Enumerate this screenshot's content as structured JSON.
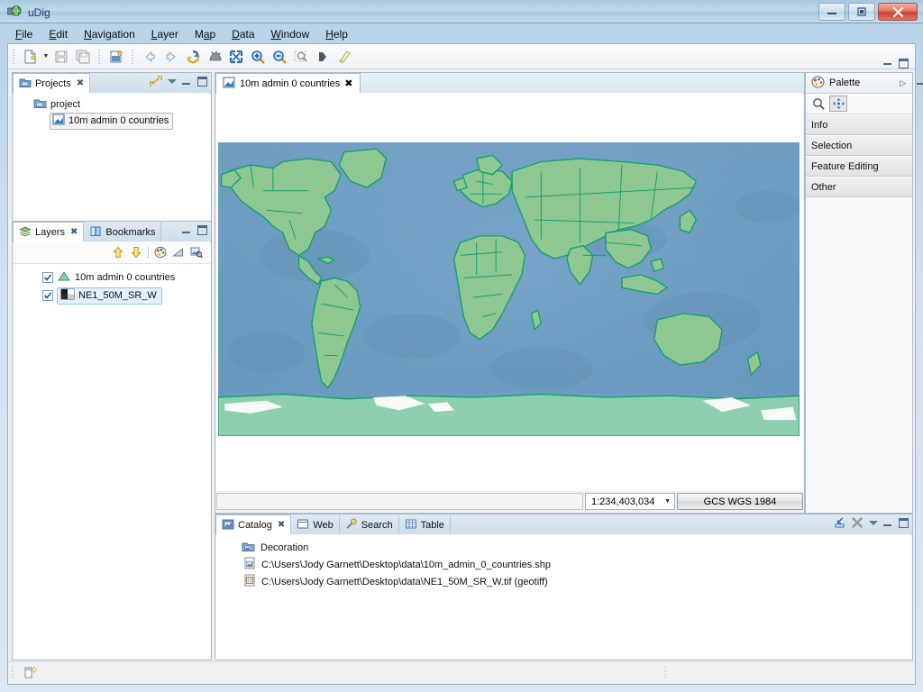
{
  "window": {
    "title": "uDig",
    "app_icon": "udig-globe-icon",
    "minimize_label": "–",
    "maximize_label": "▣",
    "close_label": "✕"
  },
  "menubar": {
    "items": [
      {
        "label": "File",
        "mnemonic": "F"
      },
      {
        "label": "Edit",
        "mnemonic": "E"
      },
      {
        "label": "Navigation",
        "mnemonic": "N"
      },
      {
        "label": "Layer",
        "mnemonic": "L"
      },
      {
        "label": "Map",
        "mnemonic": "M"
      },
      {
        "label": "Data",
        "mnemonic": "D"
      },
      {
        "label": "Window",
        "mnemonic": "W"
      },
      {
        "label": "Help",
        "mnemonic": "H"
      }
    ]
  },
  "toolbar": {
    "items": [
      {
        "name": "new-icon",
        "tooltip": "New"
      },
      {
        "name": "new-dropdown-arrow-icon",
        "tooltip": "New dropdown"
      },
      {
        "name": "save-icon",
        "tooltip": "Save"
      },
      {
        "name": "save-all-icon",
        "tooltip": "Save All"
      },
      {
        "name": "new-map-icon",
        "tooltip": "New Map"
      },
      {
        "name": "back-arrow-icon",
        "tooltip": "Back"
      },
      {
        "name": "forward-arrow-icon",
        "tooltip": "Forward"
      },
      {
        "name": "refresh-icon",
        "tooltip": "Refresh"
      },
      {
        "name": "pan-icon",
        "tooltip": "Pan"
      },
      {
        "name": "zoom-extent-icon",
        "tooltip": "Zoom to Extent"
      },
      {
        "name": "zoom-in-icon",
        "tooltip": "Zoom In"
      },
      {
        "name": "zoom-out-icon",
        "tooltip": "Zoom Out"
      },
      {
        "name": "zoom-selection-icon",
        "tooltip": "Zoom to Selection"
      },
      {
        "name": "show-view-icon",
        "tooltip": "Show View"
      },
      {
        "name": "style-editor-icon",
        "tooltip": "Style Editor"
      }
    ]
  },
  "projects_view": {
    "tab_label": "Projects",
    "tab_icon": "projects-icon",
    "close_glyph": "✖",
    "toolbar_icons": [
      "link-with-editor-icon",
      "view-menu-icon",
      "minimize-icon",
      "maximize-icon"
    ],
    "tree": [
      {
        "label": "project",
        "icon": "project-folder-icon",
        "indent": 1,
        "selected": false
      },
      {
        "label": "10m admin 0 countries",
        "icon": "map-icon",
        "indent": 2,
        "selected": true
      }
    ]
  },
  "layers_view": {
    "tabs": [
      {
        "label": "Layers",
        "icon": "layers-icon",
        "active": true,
        "close_glyph": "✖"
      },
      {
        "label": "Bookmarks",
        "icon": "bookmarks-icon",
        "active": false
      }
    ],
    "toolbar_icons": [
      "move-up-icon",
      "move-down-icon",
      "separator",
      "style-palette-icon",
      "opacity-icon",
      "zoom-to-layer-icon"
    ],
    "view_icons": [
      "minimize-icon",
      "maximize-icon"
    ],
    "layers": [
      {
        "label": "10m admin 0 countries",
        "checked": true,
        "icon": "vector-layer-icon",
        "selected": false
      },
      {
        "label": "NE1_50M_SR_W",
        "checked": true,
        "icon": "raster-layer-icon",
        "selected": true
      }
    ]
  },
  "editor": {
    "tab_label": "10m admin 0 countries",
    "tab_icon": "map-icon",
    "close_glyph": "✖",
    "view_icons": [
      "minimize-icon",
      "maximize-icon"
    ],
    "scale": "1:234,403,034",
    "scale_caret": "▼",
    "crs_label": "GCS WGS 1984"
  },
  "palette": {
    "title": "Palette",
    "icon": "palette-icon",
    "flip_glyph": "▷",
    "tools": [
      {
        "name": "zoom-tool-icon",
        "pressed": false
      },
      {
        "name": "pan-tool-icon",
        "pressed": true
      }
    ],
    "drawers": [
      {
        "label": "Info"
      },
      {
        "label": "Selection"
      },
      {
        "label": "Feature Editing"
      },
      {
        "label": "Other"
      }
    ]
  },
  "catalog_view": {
    "tabs": [
      {
        "label": "Catalog",
        "icon": "catalog-icon",
        "active": true,
        "close_glyph": "✖"
      },
      {
        "label": "Web",
        "icon": "web-icon",
        "active": false
      },
      {
        "label": "Search",
        "icon": "search-icon",
        "active": false
      },
      {
        "label": "Table",
        "icon": "table-icon",
        "active": false
      }
    ],
    "toolbar_icons": [
      "import-icon",
      "remove-icon",
      "view-menu-icon",
      "minimize-icon",
      "maximize-icon"
    ],
    "entries": [
      {
        "label": "Decoration",
        "icon": "decoration-folder-icon",
        "indent": 1
      },
      {
        "label": "C:\\Users\\Jody Garnett\\Desktop\\data\\10m_admin_0_countries.shp",
        "icon": "shapefile-icon",
        "indent": 1
      },
      {
        "label": "C:\\Users\\Jody Garnett\\Desktop\\data\\NE1_50M_SR_W.tif (geotiff)",
        "icon": "geotiff-icon",
        "indent": 1
      }
    ]
  },
  "statusbar": {
    "icon": "fast-view-icon",
    "text": ""
  },
  "colors": {
    "ocean": "#6e9ec4",
    "land": "#8fcb92",
    "land_border": "#11a06a",
    "antarctica": "#8ecfb0",
    "titlebar_accent": "#a8c7e0",
    "tab_active": "#ffffff"
  },
  "map_content": {
    "description": "World map, Natural Earth 1 50M shaded relief raster with 10m admin 0 country polygons overlay, WGS84 geographic projection, full world extent"
  }
}
